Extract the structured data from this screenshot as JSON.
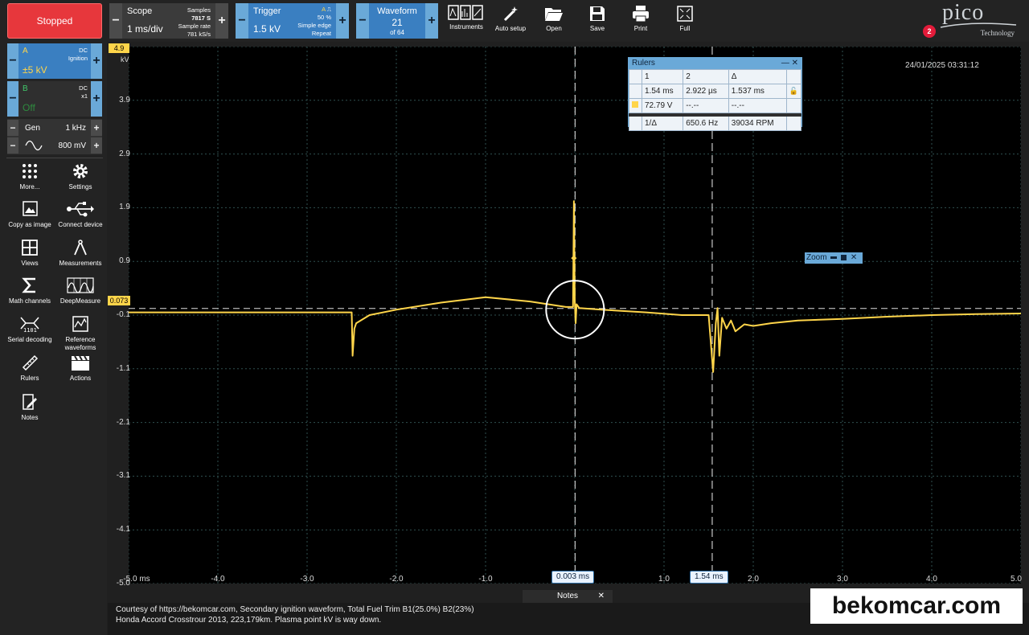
{
  "toolbar": {
    "stop_label": "Stopped",
    "scope": {
      "title": "Scope",
      "value": "1 ms/div",
      "samples_label": "Samples",
      "samples": "7817 S",
      "rate_label": "Sample rate",
      "rate": "781 kS/s"
    },
    "trigger": {
      "title": "Trigger",
      "value": "1.5 kV",
      "channel": "A",
      "level": "50 %",
      "type": "Simple edge",
      "mode": "Repeat"
    },
    "waveform": {
      "title": "Waveform",
      "value": "21",
      "of": "of 64"
    },
    "tools": [
      "Instruments",
      "Auto setup",
      "Open",
      "Save",
      "Print",
      "Full"
    ],
    "logo_text": "pico",
    "logo_sub": "Technology",
    "notification_count": "2"
  },
  "channels": [
    {
      "name": "A",
      "coupling": "DC",
      "probe": "Ignition",
      "range": "±5 kV",
      "color": "#ffd54a"
    },
    {
      "name": "B",
      "coupling": "DC",
      "probe": "x1",
      "range": "Off",
      "color": "#41c76a"
    }
  ],
  "generator": {
    "label": "Gen",
    "frequency": "1 kHz",
    "amplitude": "800 mV"
  },
  "side_tools": [
    {
      "label": "More...",
      "icon": "dots-grid-icon"
    },
    {
      "label": "Settings",
      "icon": "gear-icon"
    },
    {
      "label": "Copy as image",
      "icon": "image-icon"
    },
    {
      "label": "Connect device",
      "icon": "usb-icon"
    },
    {
      "label": "Views",
      "icon": "grid-icon"
    },
    {
      "label": "Measurements",
      "icon": "caliper-icon"
    },
    {
      "label": "Math channels",
      "icon": "sigma-icon"
    },
    {
      "label": "DeepMeasure",
      "icon": "wave-box-icon"
    },
    {
      "label": "Serial decoding",
      "icon": "serial-icon"
    },
    {
      "label": "Reference waveforms",
      "icon": "ref-wave-icon"
    },
    {
      "label": "Rulers",
      "icon": "ruler-icon"
    },
    {
      "label": "Actions",
      "icon": "clapper-icon"
    },
    {
      "label": "Notes",
      "icon": "notes-icon"
    }
  ],
  "plot": {
    "y_unit": "kV",
    "y_top_marker": "4.9",
    "y_cursor_marker": "0.073",
    "timestamp": "24/01/2025 03:31:12",
    "ruler1_label": "0.003 ms",
    "ruler2_label": "1.54 ms"
  },
  "chart_data": {
    "type": "line",
    "title": "",
    "xlabel": "",
    "ylabel": "kV",
    "xlim": [
      -5.0,
      5.0
    ],
    "ylim": [
      -5.0,
      4.9
    ],
    "x_ticks": [
      "-5.0 ms",
      "-4.0",
      "-3.0",
      "-2.0",
      "-1.0",
      "0.0",
      "1.0",
      "2.0",
      "3.0",
      "4.0",
      "5.0"
    ],
    "y_ticks": [
      "4.9",
      "3.9",
      "2.9",
      "1.9",
      "0.9",
      "-0.1",
      "-1.1",
      "-2.1",
      "-3.1",
      "-4.1",
      "-5.0"
    ],
    "grid": true,
    "series": [
      {
        "x": [
          -5.0,
          -2.5,
          -2.49,
          -2.47,
          -2.45,
          -2.3,
          -2.0,
          -1.5,
          -1.0,
          -0.5,
          -0.1,
          -0.02,
          -0.01,
          0.0,
          0.01,
          0.02,
          0.05,
          0.3,
          0.8,
          1.2,
          1.5,
          1.55,
          1.58,
          1.6,
          1.62,
          1.65,
          1.7,
          1.75,
          1.8,
          1.9,
          2.0,
          2.2,
          2.5,
          3.0,
          3.5,
          4.0,
          4.5,
          5.0
        ],
        "y": [
          0.0,
          0.0,
          -0.8,
          -0.3,
          -0.2,
          -0.05,
          0.05,
          0.18,
          0.28,
          0.2,
          0.1,
          0.1,
          2.05,
          0.2,
          -0.2,
          0.15,
          0.08,
          0.05,
          0.0,
          -0.05,
          -0.05,
          -1.1,
          -0.2,
          0.08,
          -0.8,
          -0.1,
          -0.3,
          -0.15,
          -0.35,
          -0.22,
          -0.25,
          -0.2,
          -0.15,
          -0.12,
          -0.08,
          -0.05,
          -0.03,
          -0.02
        ]
      }
    ],
    "rulers_x": [
      0.003,
      1.54
    ],
    "cursor_y": 0.073
  },
  "rulers_panel": {
    "title": "Rulers",
    "headers": [
      "1",
      "2",
      "Δ"
    ],
    "row_time": [
      "1.54 ms",
      "2.922 µs",
      "1.537 ms"
    ],
    "row_volt": [
      "72.79 V",
      "--.--",
      "--.--"
    ],
    "row_freq": [
      "1/Δ",
      "650.6 Hz",
      "39034 RPM"
    ]
  },
  "zoom_label": "Zoom",
  "notes": {
    "tab": "Notes",
    "line1": "Courtesy of https://bekomcar.com, Secondary ignition waveform, Total Fuel Trim B1(25.0%) B2(23%)",
    "line2": "Honda Accord Crosstrour 2013, 223,179km. Plasma point kV is way down."
  },
  "watermark": "bekomcar.com"
}
